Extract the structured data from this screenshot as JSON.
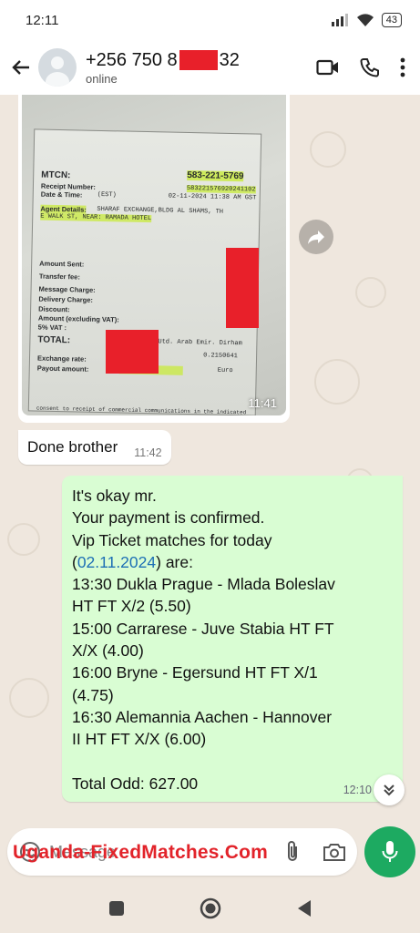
{
  "status_bar": {
    "time": "12:11",
    "battery": "43"
  },
  "header": {
    "contact_prefix": "+256 750 8",
    "contact_suffix": "32",
    "status": "online"
  },
  "receipt_image": {
    "mtcn_label": "MTCN:",
    "mtcn_value": "583-221-5769",
    "receipt_number_label": "Receipt Number:",
    "receipt_number_value": "583221576920241102",
    "date_time_label": "Date & Time:",
    "date_time_zone": "(EST)",
    "date_time_value": "02-11-2024 11:38 AM GST",
    "agent_label": "Agent Details:",
    "agent_value_1": "SHARAF EXCHANGE,BLDG AL SHAMS, TH",
    "agent_value_2": "E WALK ST, NEAR: RAMADA HOTEL",
    "amount_sent": "Amount Sent:",
    "transfer_fee": "Transfer fee:",
    "message_charge": "Message Charge:",
    "delivery_charge": "Delivery Charge:",
    "discount": "Discount:",
    "amount_excl_vat": "Amount (excluding VAT):",
    "vat": "5% VAT :",
    "total": "TOTAL:",
    "currency_from": "Utd. Arab Emir. Dirham",
    "exchange_rate_label": "Exchange rate:",
    "exchange_rate_value": "0.2150641",
    "payout_label": "Payout amount:",
    "currency_to": "Euro",
    "footer": "consent to receipt of commercial communications in the indicated",
    "time": "11:41"
  },
  "messages": {
    "incoming": {
      "text": "Done brother",
      "time": "11:42"
    },
    "outgoing": {
      "line1": "It's okay mr.",
      "line2": "Your payment is confirmed.",
      "line3": "Vip Ticket matches for today",
      "line4_open": "(",
      "line4_date": "02.11.2024",
      "line4_close": ") are:",
      "line5": "13:30 Dukla Prague - Mlada Boleslav",
      "line6": "HT FT X/2 (5.50)",
      "line7": "15:00 Carrarese - Juve Stabia HT FT",
      "line8": "X/X (4.00)",
      "line9": "16:00 Bryne - Egersund HT FT X/1",
      "line10": "(4.75)",
      "line11": "16:30  Alemannia Aachen - Hannover",
      "line12": "II HT FT X/X (6.00)",
      "line13": "Total Odd: 627.00",
      "time": "12:10"
    }
  },
  "input": {
    "placeholder": "Message"
  },
  "watermark": "Uganda-FixedMatches.Com",
  "colors": {
    "accent_green": "#1daa61",
    "outgoing_bubble": "#d9fdd3",
    "redaction": "#e8202a",
    "watermark": "#e2232a"
  }
}
